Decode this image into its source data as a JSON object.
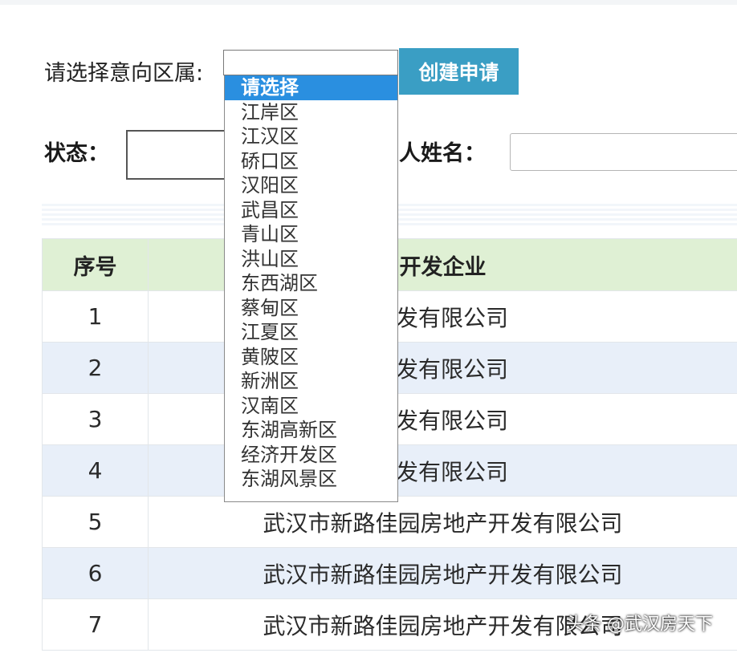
{
  "form": {
    "district_label": "请选择意向区属:",
    "district_select_value": "",
    "create_button_label": "创建申请",
    "status_label": "状态：",
    "status_value": "",
    "applicant_label": "人姓名：",
    "applicant_value": ""
  },
  "dropdown": {
    "selected_index": 0,
    "options": [
      "请选择",
      "江岸区",
      "江汉区",
      "硚口区",
      "汉阳区",
      "武昌区",
      "青山区",
      "洪山区",
      "东西湖区",
      "蔡甸区",
      "江夏区",
      "黄陂区",
      "新洲区",
      "汉南区",
      "东湖高新区",
      "经济开发区",
      "东湖风景区"
    ]
  },
  "table": {
    "headers": [
      "序号",
      "开发企业"
    ],
    "rows": [
      {
        "index": "1",
        "company": "佳园房地产开发有限公司"
      },
      {
        "index": "2",
        "company": "佳园房地产开发有限公司"
      },
      {
        "index": "3",
        "company": "佳园房地产开发有限公司"
      },
      {
        "index": "4",
        "company": "佳园房地产开发有限公司"
      },
      {
        "index": "5",
        "company": "武汉市新路佳园房地产开发有限公司"
      },
      {
        "index": "6",
        "company": "武汉市新路佳园房地产开发有限公司"
      },
      {
        "index": "7",
        "company": "武汉市新路佳园房地产开发有限公司"
      }
    ]
  },
  "watermark": "头条 @武汉房天下",
  "colors": {
    "button_bg": "#3a9ec4",
    "header_bg": "#dff0d4",
    "row_alt_bg": "#e8eff9",
    "dropdown_selected_bg": "#2a8fe0"
  }
}
